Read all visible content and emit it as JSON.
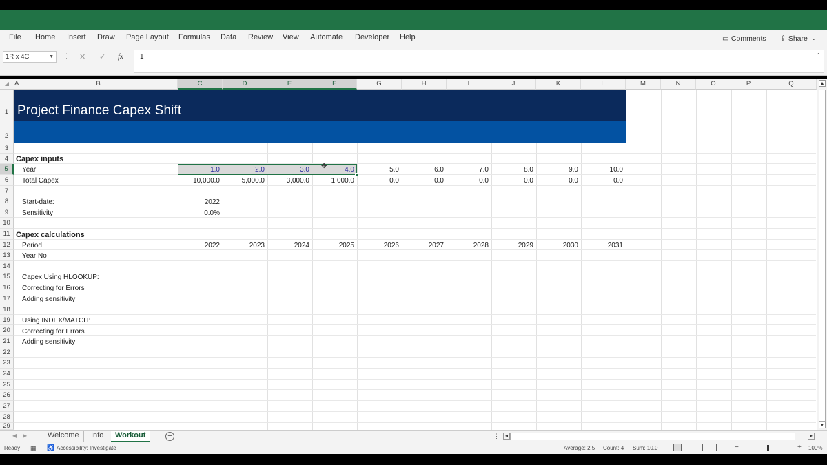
{
  "ribbon": {
    "menus": [
      "File",
      "Home",
      "Insert",
      "Draw",
      "Page Layout",
      "Formulas",
      "Data",
      "Review",
      "View",
      "Automate",
      "Developer",
      "Help"
    ],
    "comments": "Comments",
    "share": "Share"
  },
  "formula_bar": {
    "name_box": "1R x 4C",
    "cancel": "✕",
    "enter": "✓",
    "fx": "fx",
    "value": "1"
  },
  "columns": [
    "A",
    "B",
    "C",
    "D",
    "E",
    "F",
    "G",
    "H",
    "I",
    "J",
    "K",
    "L",
    "M",
    "N",
    "O",
    "P",
    "Q"
  ],
  "rows": [
    "1",
    "2",
    "3",
    "4",
    "5",
    "6",
    "7",
    "8",
    "9",
    "10",
    "11",
    "12",
    "13",
    "14",
    "15",
    "16",
    "17",
    "18",
    "19",
    "20",
    "21",
    "22",
    "23",
    "24",
    "25",
    "26",
    "27",
    "28",
    "29"
  ],
  "sheet": {
    "title": "Project Finance Capex Shift",
    "capex_inputs": "Capex inputs",
    "year_label": "Year",
    "year_values": [
      "1.0",
      "2.0",
      "3.0",
      "4.0",
      "5.0",
      "6.0",
      "7.0",
      "8.0",
      "9.0",
      "10.0"
    ],
    "total_capex_label": "Total Capex",
    "total_capex_values": [
      "10,000.0",
      "5,000.0",
      "3,000.0",
      "1,000.0",
      "0.0",
      "0.0",
      "0.0",
      "0.0",
      "0.0",
      "0.0"
    ],
    "start_date_label": "Start-date:",
    "start_date_value": "2022",
    "sensitivity_label": "Sensitivity",
    "sensitivity_value": "0.0%",
    "capex_calculations": "Capex calculations",
    "period_label": "Period",
    "period_values": [
      "2022",
      "2023",
      "2024",
      "2025",
      "2026",
      "2027",
      "2028",
      "2029",
      "2030",
      "2031"
    ],
    "year_no_label": "Year No",
    "hlookup_label": "Capex Using HLOOKUP:",
    "correcting1": "Correcting for Errors",
    "adding1": "Adding sensitivity",
    "index_match_label": "Using INDEX/MATCH:",
    "correcting2": "Correcting for Errors",
    "adding2": "Adding sensitivity"
  },
  "tabs": [
    "Welcome",
    "Info",
    "Workout"
  ],
  "active_tab": "Workout",
  "status": {
    "ready": "Ready",
    "accessibility": "Accessibility: Investigate",
    "average": "Average: 2.5",
    "count": "Count: 4",
    "sum": "Sum: 10.0",
    "zoom": "100%"
  },
  "colors": {
    "green": "#217346",
    "navy": "#0b2a5c",
    "blue": "#0352a2",
    "value_blue": "#2a2a9c"
  }
}
